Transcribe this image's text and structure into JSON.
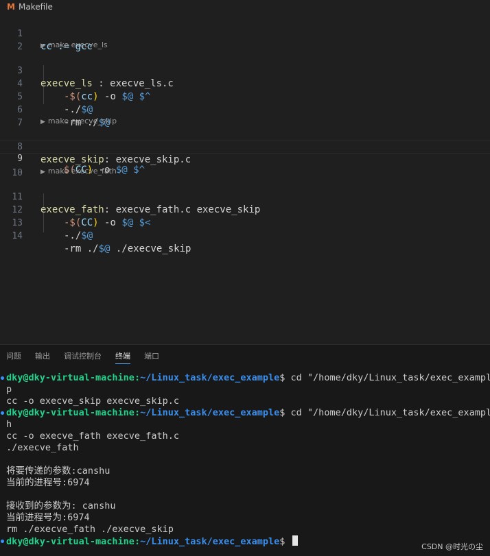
{
  "tab": {
    "icon": "M",
    "filename": "Makefile"
  },
  "editor": {
    "codelens": [
      "make execve_ls",
      "make execve_skip",
      "make execve_fath"
    ],
    "lines": {
      "l1": "cc := gcc",
      "l3a": "execve_ls",
      "l3b": " : execve_ls.c",
      "l4a": "-$(",
      "l4b": "cc",
      "l4c": ")",
      "l4d": " -o ",
      "l4e": "$@",
      "l4f": " ",
      "l4g": "$^",
      "l5a": "-./",
      "l5b": "$@",
      "l6a": "-rm ./",
      "l6b": "$@",
      "l8a": "execve_skip",
      "l8b": ": execve_skip.c",
      "l9a": "$(",
      "l9b": "CC",
      "l9c": ")",
      "l9d": " -o ",
      "l9e": "$@",
      "l9f": " ",
      "l9g": "$^",
      "l11a": "execve_fath",
      "l11b": ": execve_fath.c execve_skip",
      "l12a": "-$(",
      "l12b": "CC",
      "l12c": ")",
      "l12d": " -o ",
      "l12e": "$@",
      "l12f": " ",
      "l12g": "$<",
      "l13a": "-./",
      "l13b": "$@",
      "l14a": "-rm ./",
      "l14b": "$@",
      "l14c": " ./execve_skip"
    },
    "line_numbers": [
      "1",
      "2",
      "3",
      "4",
      "5",
      "6",
      "7",
      "8",
      "9",
      "10",
      "11",
      "12",
      "13",
      "14"
    ]
  },
  "panel": {
    "tabs": [
      "问题",
      "输出",
      "调试控制台",
      "终端",
      "端口"
    ],
    "active_tab": "终端"
  },
  "terminal": {
    "user": "dky@dky-virtual-machine",
    "sep": ":",
    "path": "~/Linux_task/exec_example",
    "prompt": "$ ",
    "cmd1": "cd \"/home/dky/Linux_task/exec_example",
    "wrap1": "p",
    "out1": "cc -o execve_skip execve_skip.c",
    "cmd2": "cd \"/home/dky/Linux_task/exec_example",
    "wrap2": "h",
    "out2a": "cc -o execve_fath execve_fath.c",
    "out2b": "./execve_fath",
    "out3": "将要传递的参数:canshu",
    "out4": "当前的进程号:6974",
    "out5": "接收到的参数为: canshu",
    "out6": "当前进程号为:6974",
    "out7": "rm ./execve_fath ./execve_skip"
  },
  "watermark": "CSDN @时光の尘",
  "colors": {
    "accent": "#3794ff",
    "user_green": "#23d18b",
    "path_blue": "#3b8eea"
  }
}
